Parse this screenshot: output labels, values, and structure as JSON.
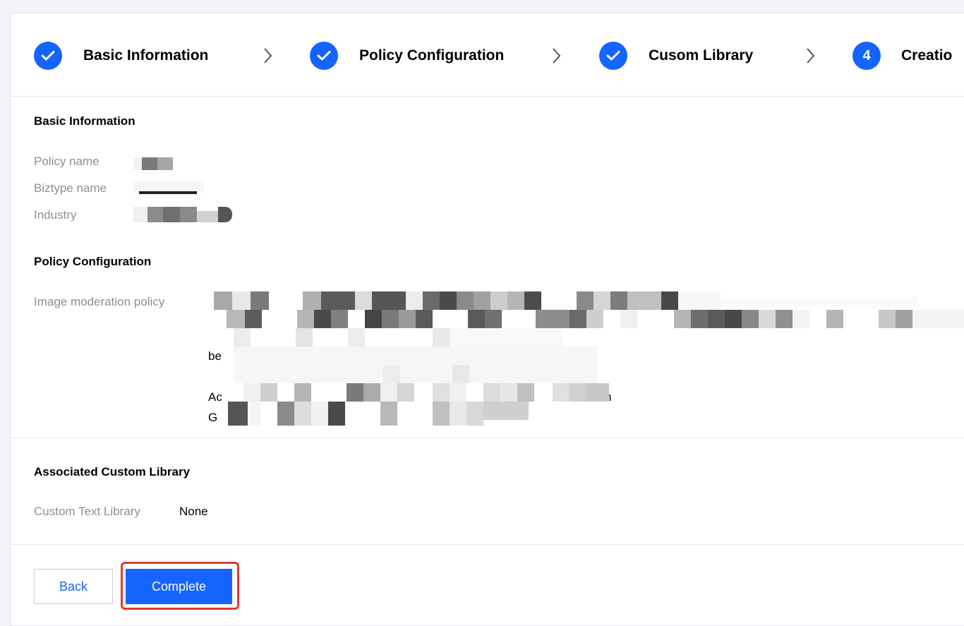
{
  "steps": [
    {
      "label": "Basic Information",
      "state": "done",
      "icon": "check-icon"
    },
    {
      "label": "Policy Configuration",
      "state": "done",
      "icon": "check-icon"
    },
    {
      "label": "Cusom Library",
      "state": "done",
      "icon": "check-icon"
    },
    {
      "label": "Creatio",
      "state": "current",
      "number": "4"
    }
  ],
  "basic_info": {
    "title": "Basic Information",
    "policy_name_label": "Policy name",
    "biztype_name_label": "Biztype name",
    "industry_label": "Industry"
  },
  "policy_config": {
    "title": "Policy Configuration",
    "image_moderation_label": "Image moderation policy",
    "visible_fragments": [
      "be",
      "Ac",
      "G",
      "n"
    ]
  },
  "custom_library": {
    "title": "Associated Custom Library",
    "text_library_label": "Custom Text Library",
    "text_library_value": "None"
  },
  "buttons": {
    "back_label": "Back",
    "complete_label": "Complete"
  },
  "colors": {
    "accent": "#1664ff",
    "highlight": "#e03a2e",
    "muted_text": "#8b8f99"
  }
}
